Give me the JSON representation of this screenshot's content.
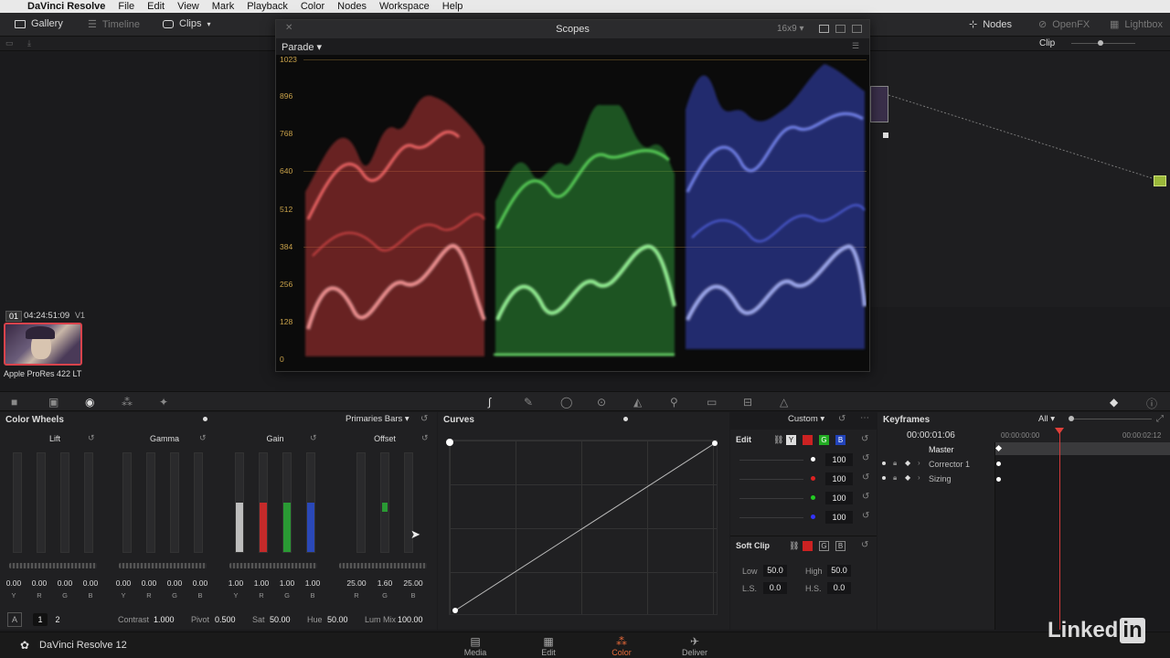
{
  "menubar": {
    "app_name": "DaVinci Resolve",
    "items": [
      "File",
      "Edit",
      "View",
      "Mark",
      "Playback",
      "Color",
      "Nodes",
      "Workspace",
      "Help"
    ]
  },
  "toolbar": {
    "gallery": "Gallery",
    "timeline": "Timeline",
    "clips": "Clips",
    "nodes": "Nodes",
    "openfx": "OpenFX",
    "lightbox": "Lightbox",
    "clip_mode": "Clip"
  },
  "scopes": {
    "title": "Scopes",
    "aspect": "16x9",
    "mode": "Parade",
    "y_ticks": [
      "1023",
      "896",
      "768",
      "640",
      "512",
      "384",
      "256",
      "128",
      "0"
    ]
  },
  "clip": {
    "number": "01",
    "timecode": "04:24:51:09",
    "track": "V1",
    "codec": "Apple ProRes 422 LT"
  },
  "color_wheels": {
    "title": "Color Wheels",
    "mode": "Primaries Bars",
    "wheels": [
      {
        "name": "Lift",
        "values": [
          "0.00",
          "0.00",
          "0.00",
          "0.00"
        ],
        "labels": [
          "Y",
          "R",
          "G",
          "B"
        ]
      },
      {
        "name": "Gamma",
        "values": [
          "0.00",
          "0.00",
          "0.00",
          "0.00"
        ],
        "labels": [
          "Y",
          "R",
          "G",
          "B"
        ]
      },
      {
        "name": "Gain",
        "values": [
          "1.00",
          "1.00",
          "1.00",
          "1.00"
        ],
        "labels": [
          "Y",
          "R",
          "G",
          "B"
        ]
      },
      {
        "name": "Offset",
        "values": [
          "25.00",
          "1.60",
          "25.00"
        ],
        "labels": [
          "R",
          "G",
          "B"
        ]
      }
    ],
    "bottom": {
      "a_label": "A",
      "page1": "1",
      "page2": "2",
      "contrast_label": "Contrast",
      "contrast": "1.000",
      "pivot_label": "Pivot",
      "pivot": "0.500",
      "sat_label": "Sat",
      "sat": "50.00",
      "hue_label": "Hue",
      "hue": "50.00",
      "lummix_label": "Lum Mix",
      "lummix": "100.00"
    }
  },
  "curves": {
    "title": "Curves",
    "mode": "Custom"
  },
  "edit": {
    "title": "Edit",
    "channels": [
      "Y",
      "R",
      "G",
      "B"
    ],
    "values": [
      "100",
      "100",
      "100",
      "100"
    ],
    "soft_clip": "Soft Clip",
    "low_label": "Low",
    "low": "50.0",
    "high_label": "High",
    "high": "50.0",
    "ls_label": "L.S.",
    "ls": "0.0",
    "hs_label": "H.S.",
    "hs": "0.0"
  },
  "keyframes": {
    "title": "Keyframes",
    "filter": "All",
    "timecode": "00:00:01:06",
    "ruler_start": "00:00:00:00",
    "ruler_end": "00:00:02:12",
    "rows": [
      "Master",
      "Corrector 1",
      "Sizing"
    ]
  },
  "bottombar": {
    "product": "DaVinci Resolve 12",
    "tabs": [
      "Media",
      "Edit",
      "Color",
      "Deliver"
    ],
    "active_tab": "Color"
  },
  "branding": {
    "linkedin": "Linked",
    "linkedin_in": "in"
  },
  "colors": {
    "accent": "#e86a3a",
    "red": "#d23a3a",
    "green": "#2fa83a",
    "blue": "#3a55d8"
  }
}
